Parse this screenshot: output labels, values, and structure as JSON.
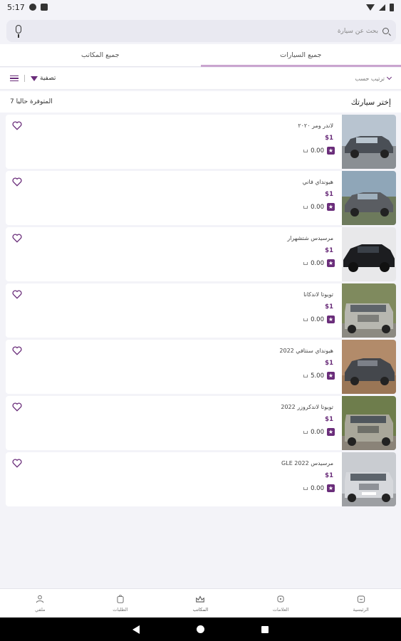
{
  "status_bar": {
    "time": "5:17"
  },
  "search": {
    "placeholder": "بحث عن سيارة"
  },
  "tabs": [
    {
      "label": "جميع السيارات",
      "active": true
    },
    {
      "label": "جميع المكاتب",
      "active": false
    }
  ],
  "toolbar": {
    "sort_label": "ترتيب حسب",
    "filter_label": "تصفية"
  },
  "header": {
    "title": "إختر سيارتك",
    "count": "7 المتوفرة حاليا"
  },
  "cars": [
    {
      "name": "لاندر ومر ٢٠٢٠",
      "price": "$1",
      "rating": "0.00",
      "image": "car-range-rover"
    },
    {
      "name": "هيونداي فاني",
      "price": "$1",
      "rating": "0.00",
      "image": "car-hyundai"
    },
    {
      "name": "مرسيدس شتشهرار",
      "price": "$1",
      "rating": "0.00",
      "image": "car-mercedes-black"
    },
    {
      "name": "تويوتا لاندكانا",
      "price": "$1",
      "rating": "0.00",
      "image": "car-toyota"
    },
    {
      "name": "هيونداي سنتافي 2022",
      "price": "$1",
      "rating": "5.00",
      "image": "car-santafe"
    },
    {
      "name": "تويوتا لاندكروزر 2022",
      "price": "$1",
      "rating": "0.00",
      "image": "car-landcruiser"
    },
    {
      "name": "مرسيدس GLE 2022",
      "price": "$1",
      "rating": "0.00",
      "image": "car-gle"
    }
  ],
  "bottom_nav": [
    {
      "label": "الرئيسية",
      "icon": "home-icon"
    },
    {
      "label": "العلامات",
      "icon": "brands-icon"
    },
    {
      "label": "المكاتب",
      "icon": "offices-icon"
    },
    {
      "label": "الطلبات",
      "icon": "orders-icon"
    },
    {
      "label": "ملفي",
      "icon": "profile-icon"
    }
  ],
  "colors": {
    "accent": "#6a2d7a",
    "tab_indicator": "#c9a5cf",
    "background": "#f3f3f8"
  }
}
